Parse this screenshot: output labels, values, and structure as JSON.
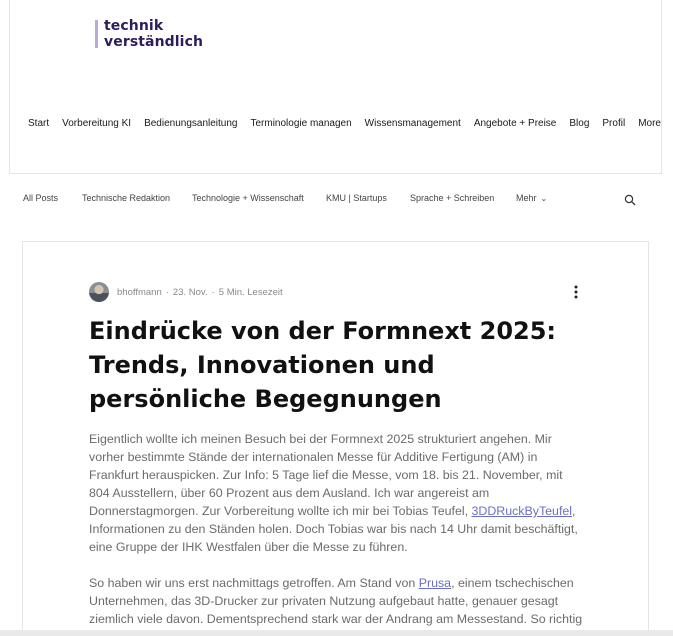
{
  "logo": {
    "line1": "technik",
    "line2": "verständlich"
  },
  "main_nav": [
    "Start",
    "Vorbereitung KI",
    "Bedienungsanleitung",
    "Terminologie managen",
    "Wissensmanagement",
    "Angebote + Preise",
    "Blog",
    "Profil",
    "More"
  ],
  "blog_nav": {
    "categories": [
      "All Posts",
      "Technische Redaktion",
      "Technologie + Wissenschaft",
      "KMU | Startups",
      "Sprache + Schreiben"
    ],
    "more_label": "Mehr"
  },
  "post": {
    "author": "bhoffmann",
    "date": "23. Nov.",
    "read_time": "5 Min. Lesezeit",
    "title": "Eindrücke von der Formnext 2025: Trends, Innovationen und persönliche Begegnungen",
    "p1_a": "Eigentlich wollte ich meinen Besuch bei der Formnext 2025 strukturiert angehen. Mir vorher bestimmte Stände der internationalen Messe für Additive Fertigung (AM) in Frankfurt herauspicken. Zur Info: 5 Tage lief die Messe, vom 18. bis 21. November, mit 804 Ausstellern, über 60 Prozent aus dem Ausland. Ich war angereist am Donnerstagmorgen. Zur Vorbereitung wollte ich mir bei Tobias Teufel, ",
    "p1_link": "3DDRuckByTeufel",
    "p1_b": ", Informationen zu den Ständen holen. Doch Tobias war bis nach 14 Uhr damit beschäftigt, eine Gruppe der IHK Westfalen über die Messe zu führen.",
    "p2_a": "So haben wir uns erst nachmittags getroffen. Am Stand von ",
    "p2_link": "Prusa",
    "p2_b": ", einem tschechischen Unternehmen, das 3D-Drucker zur privaten Nutzung aufgebaut hatte, genauer gesagt ziemlich viele davon. Dementsprechend stark war der Andrang am Messestand. So richtig was Neues gebe es in diesem Jahr nicht, berichtet Tobias, ja"
  }
}
